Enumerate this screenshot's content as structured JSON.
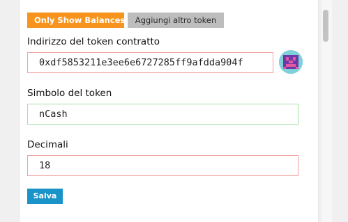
{
  "toolbar": {
    "only_show_balances_label": "Only Show Balances",
    "add_token_label": "Aggiungi altro token"
  },
  "form": {
    "address": {
      "label": "Indirizzo del token contratto",
      "value": "0xdf5853211e3ee6e6727285ff9afdda904f"
    },
    "symbol": {
      "label": "Simbolo del token",
      "value": "nCash"
    },
    "decimals": {
      "label": "Decimali",
      "value": "18"
    },
    "save_label": "Salva"
  },
  "colors": {
    "accent_orange": "#f7941d",
    "save_blue": "#1a93c9",
    "invalid_border": "#f4a0a0",
    "valid_border": "#a6e0a6"
  },
  "icons": {
    "identicon": "address-identicon"
  }
}
